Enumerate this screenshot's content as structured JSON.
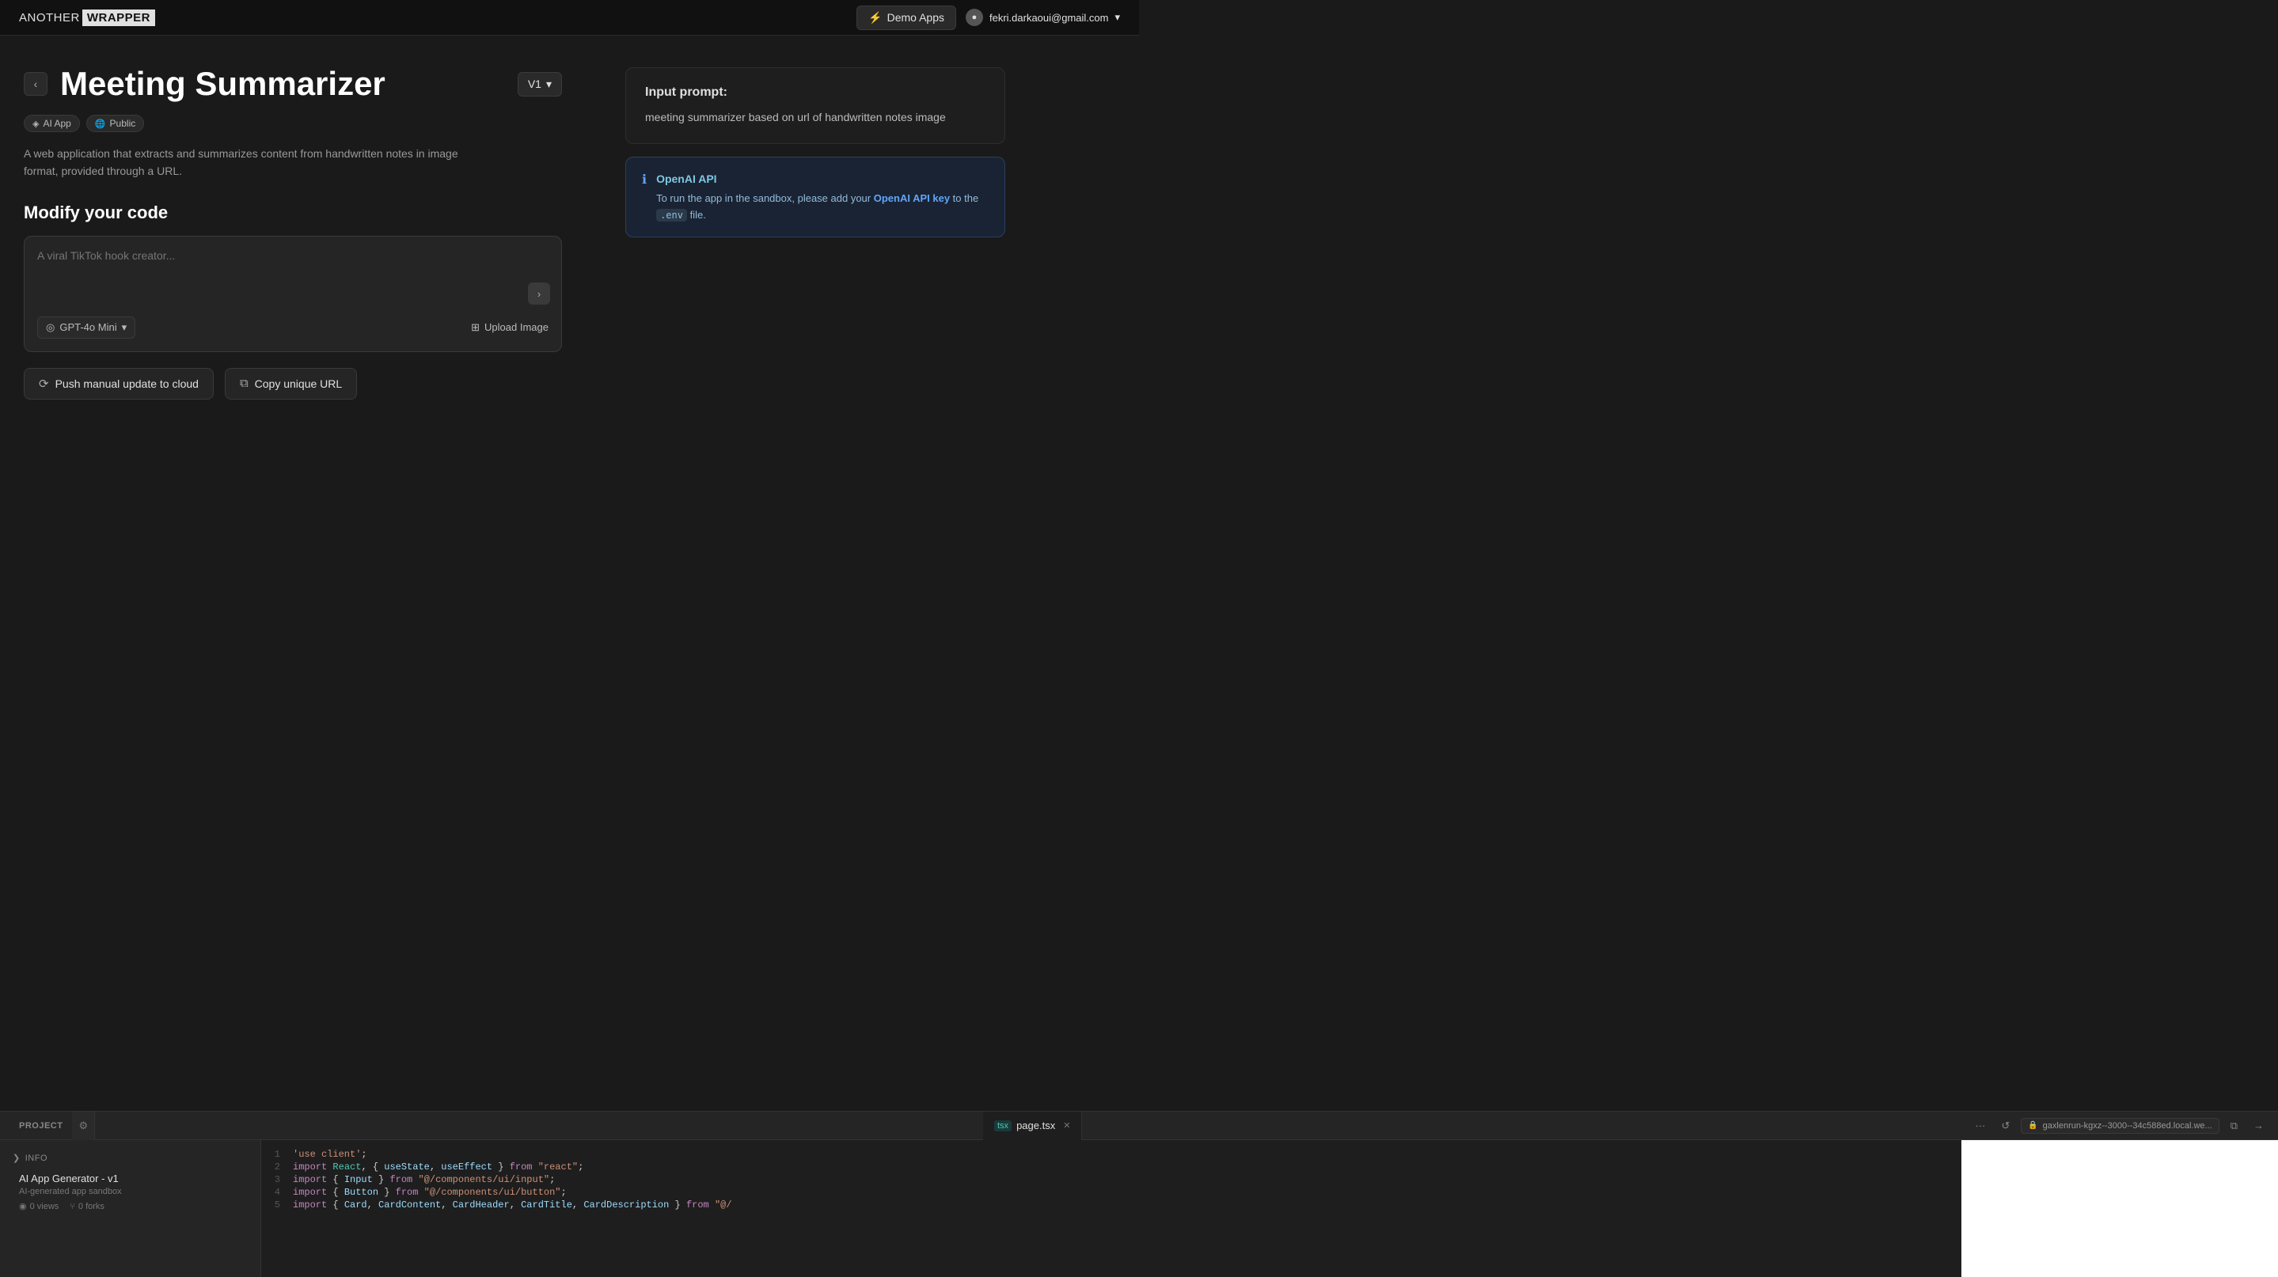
{
  "header": {
    "logo_another": "ANOTHER",
    "logo_wrapper": "WRAPPER",
    "demo_apps_label": "Demo Apps",
    "user_email": "fekri.darkaoui@gmail.com"
  },
  "page": {
    "title": "Meeting Summarizer",
    "version": "V1",
    "tag_ai": "AI App",
    "tag_public": "Public",
    "description": "A web application that extracts and summarizes content from handwritten notes in image format, provided through a URL.",
    "modify_heading": "Modify your code",
    "textarea_placeholder": "A viral TikTok hook creator...",
    "model_label": "GPT-4o Mini",
    "upload_label": "Upload Image",
    "push_label": "Push manual update to cloud",
    "copy_url_label": "Copy unique URL"
  },
  "right_panel": {
    "prompt_label": "Input prompt:",
    "prompt_text": "meeting summarizer based on url of handwritten notes image",
    "api_title": "OpenAI API",
    "api_notice": "To run the app in the sandbox, please add your ",
    "api_key_link": "OpenAI API key",
    "api_notice_suffix": " to the ",
    "api_env": ".env",
    "api_notice_end": " file."
  },
  "editor": {
    "project_label": "PROJECT",
    "tab_filename": "page.tsx",
    "url_text": "gaxlenrun-kgxz--3000--34c588ed.local.we...",
    "info_label": "INFO",
    "app_name": "AI App Generator - v1",
    "app_sub": "AI-generated app sandbox",
    "views_count": "0 views",
    "forks_count": "0 forks",
    "code_lines": [
      {
        "num": "1",
        "content": "'use client';"
      },
      {
        "num": "2",
        "content": "import React, { useState, useEffect } from \"react\";"
      },
      {
        "num": "3",
        "content": "import { Input } from \"@/components/ui/input\";"
      },
      {
        "num": "4",
        "content": "import { Button } from \"@/components/ui/button\";"
      },
      {
        "num": "5",
        "content": "import { Card, CardContent, CardHeader, CardTitle, CardDescription } from \"@/"
      }
    ]
  },
  "icons": {
    "back": "‹",
    "chevron_down": "▾",
    "bolt": "⚡",
    "user_circle": "●",
    "ai_tag": "◈",
    "globe": "🌐",
    "send": "›",
    "model_icon": "◎",
    "image_icon": "⊞",
    "push_icon": "⟳",
    "copy_icon": "⧉",
    "info_circle": "ℹ",
    "lock": "🔒",
    "refresh": "↺",
    "dots": "···",
    "external": "⧉",
    "arrow_right": "→",
    "eye": "◉",
    "fork": "⑂",
    "chevron_right": "❯",
    "tsx": "tsx"
  }
}
